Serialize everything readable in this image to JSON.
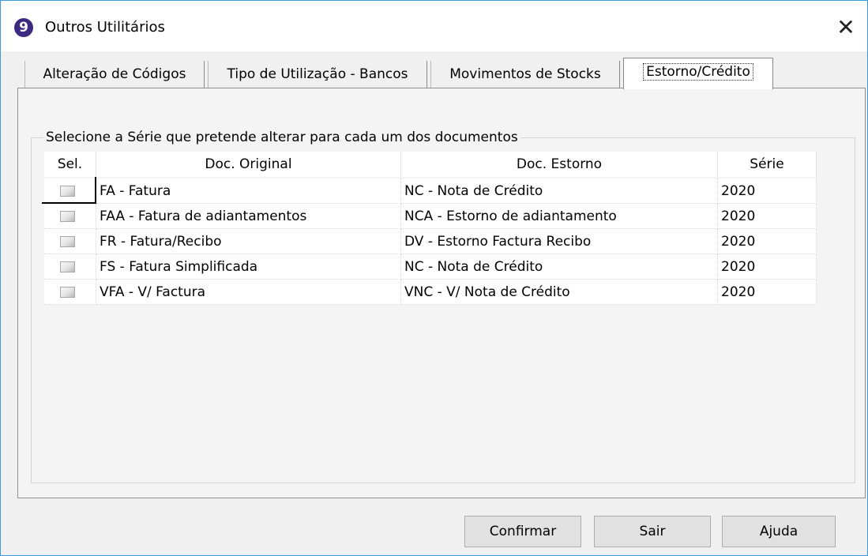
{
  "window": {
    "title": "Outros Utilitários",
    "icon": "app-logo-icon",
    "close_glyph": "✕"
  },
  "tabs": [
    {
      "label": "Alteração de Códigos",
      "active": false
    },
    {
      "label": "Tipo de Utilização - Bancos",
      "active": false
    },
    {
      "label": "Movimentos de Stocks",
      "active": false
    },
    {
      "label": "Estorno/Crédito",
      "active": true
    }
  ],
  "group": {
    "legend": "Selecione a Série que pretende alterar para cada um dos documentos"
  },
  "table": {
    "columns": [
      "Sel.",
      "Doc. Original",
      "Doc. Estorno",
      "Série"
    ],
    "rows": [
      {
        "selected": false,
        "original": "FA - Fatura",
        "estorno": "NC - Nota de Crédito",
        "serie": "2020"
      },
      {
        "selected": false,
        "original": "FAA - Fatura de adiantamentos",
        "estorno": "NCA - Estorno de adiantamento",
        "serie": "2020"
      },
      {
        "selected": false,
        "original": "FR - Fatura/Recibo",
        "estorno": "DV - Estorno Factura Recibo",
        "serie": "2020"
      },
      {
        "selected": false,
        "original": "FS - Fatura Simplificada",
        "estorno": "NC - Nota de Crédito",
        "serie": "2020"
      },
      {
        "selected": false,
        "original": "VFA - V/ Factura",
        "estorno": "VNC - V/ Nota de Crédito",
        "serie": "2020"
      }
    ]
  },
  "buttons": {
    "confirm": "Confirmar",
    "exit": "Sair",
    "help": "Ajuda"
  },
  "colors": {
    "window_border": "#3c9be0",
    "icon_bg": "#3c2a82"
  }
}
